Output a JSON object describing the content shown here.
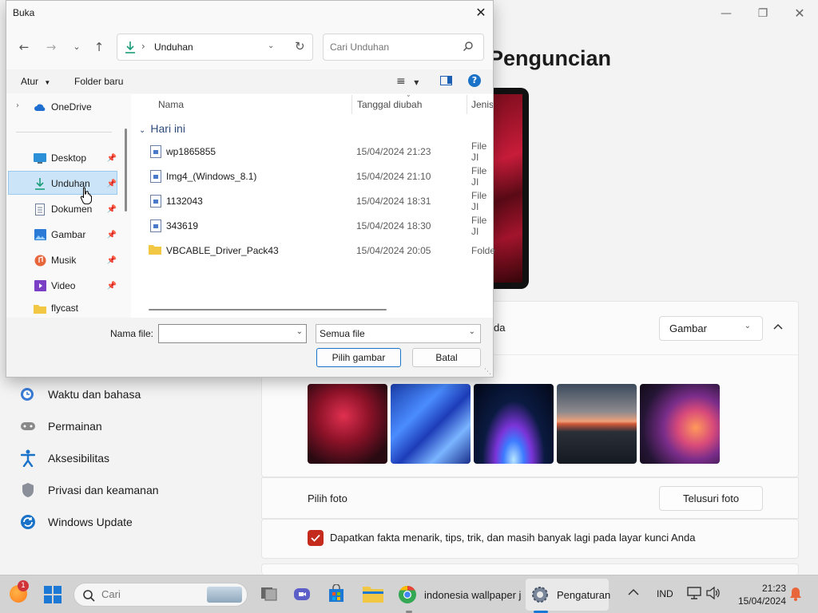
{
  "settings": {
    "heading": "Penguncian",
    "sidebar": [
      {
        "label": "Waktu dan bahasa",
        "icon": "clock-globe-icon"
      },
      {
        "label": "Permainan",
        "icon": "gamepad-icon"
      },
      {
        "label": "Aksesibilitas",
        "icon": "accessibility-icon"
      },
      {
        "label": "Privasi dan keamanan",
        "icon": "shield-icon"
      },
      {
        "label": "Windows Update",
        "icon": "refresh-icon"
      }
    ],
    "personalize_row_label": "da",
    "personalize_select": "Gambar",
    "recent_images_label": "",
    "choose_photo_label": "Pilih foto",
    "browse_button": "Telusuri foto",
    "fun_facts_label": "Dapatkan fakta menarik, tips, trik, dan masih banyak lagi pada layar kunci Anda",
    "fun_facts_checked": true,
    "accent": "#c42b1c"
  },
  "dialog": {
    "title": "Buka",
    "address": "Unduhan",
    "search_placeholder": "Cari Unduhan",
    "toolbar": {
      "organize": "Atur",
      "new_folder": "Folder baru"
    },
    "nav": [
      {
        "label": "OneDrive",
        "icon": "cloud-icon",
        "pinned": false
      },
      {
        "label": "Desktop",
        "icon": "desktop-icon",
        "pinned": true
      },
      {
        "label": "Unduhan",
        "icon": "download-icon",
        "pinned": true,
        "selected": true
      },
      {
        "label": "Dokumen",
        "icon": "document-icon",
        "pinned": true
      },
      {
        "label": "Gambar",
        "icon": "picture-icon",
        "pinned": true
      },
      {
        "label": "Musik",
        "icon": "music-icon",
        "pinned": true
      },
      {
        "label": "Video",
        "icon": "video-icon",
        "pinned": true
      },
      {
        "label": "flycast",
        "icon": "folder-icon",
        "pinned": false
      }
    ],
    "columns": {
      "name": "Nama",
      "date": "Tanggal diubah",
      "type": "Jenis"
    },
    "group_label": "Hari ini",
    "files": [
      {
        "name": "wp1865855",
        "date": "15/04/2024 21:23",
        "type": "File JI",
        "icon": "image-file-icon"
      },
      {
        "name": "Img4_(Windows_8.1)",
        "date": "15/04/2024 21:10",
        "type": "File JI",
        "icon": "image-file-icon"
      },
      {
        "name": "1132043",
        "date": "15/04/2024 18:31",
        "type": "File JI",
        "icon": "image-file-icon"
      },
      {
        "name": "343619",
        "date": "15/04/2024 18:30",
        "type": "File JI",
        "icon": "image-file-icon"
      },
      {
        "name": "VBCABLE_Driver_Pack43",
        "date": "15/04/2024 20:05",
        "type": "Folde",
        "icon": "folder-icon"
      }
    ],
    "filename_label": "Nama file:",
    "filename_value": "",
    "filetype_value": "Semua file",
    "ok_button": "Pilih gambar",
    "cancel_button": "Batal"
  },
  "taskbar": {
    "search_placeholder": "Cari",
    "notification_badge": "1",
    "apps": [
      {
        "label": "indonesia wallpaper j",
        "icon": "chrome-icon"
      },
      {
        "label": "Pengaturan",
        "icon": "settings-gear-icon"
      }
    ],
    "language": "IND",
    "time": "21:23",
    "date": "15/04/2024"
  }
}
